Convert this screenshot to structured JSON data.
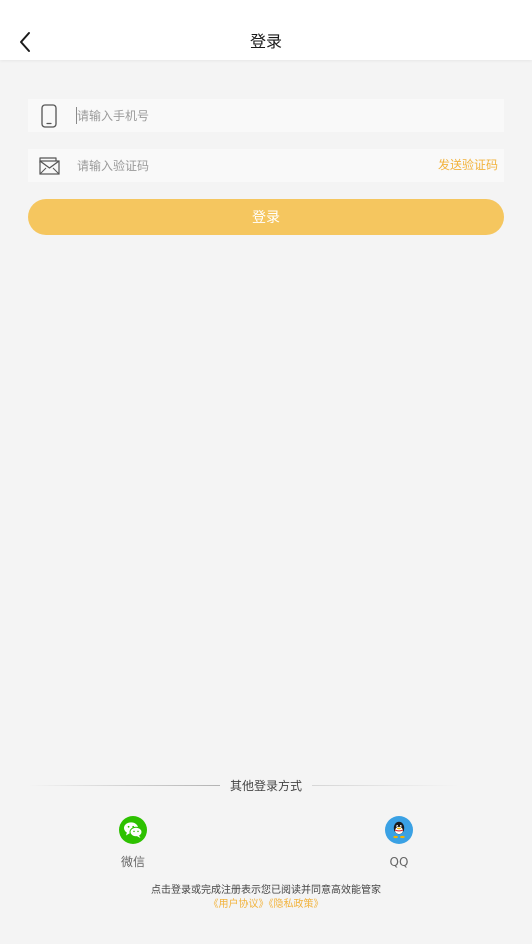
{
  "header": {
    "title": "登录",
    "back_icon": "chevron-left-icon"
  },
  "phone_field": {
    "icon": "smartphone-icon",
    "placeholder": "请输入手机号",
    "value": ""
  },
  "code_field": {
    "icon": "envelope-icon",
    "placeholder": "请输入验证码",
    "value": "",
    "send_label": "发送验证码"
  },
  "login_button": {
    "label": "登录"
  },
  "other_login": {
    "divider_label": "其他登录方式",
    "methods": [
      {
        "label": "微信",
        "icon": "wechat-icon",
        "color": "#2dc100"
      },
      {
        "label": "QQ",
        "icon": "qq-icon",
        "color": "#3aa1e4"
      }
    ]
  },
  "agreement": {
    "text": "点击登录或完成注册表示您已阅读并同意高效能管家",
    "user_agreement": "《用户协议》",
    "privacy_policy": "《隐私政策》"
  },
  "colors": {
    "accent": "#f5c65f",
    "link": "#f2b33d",
    "background": "#f4f4f4"
  }
}
